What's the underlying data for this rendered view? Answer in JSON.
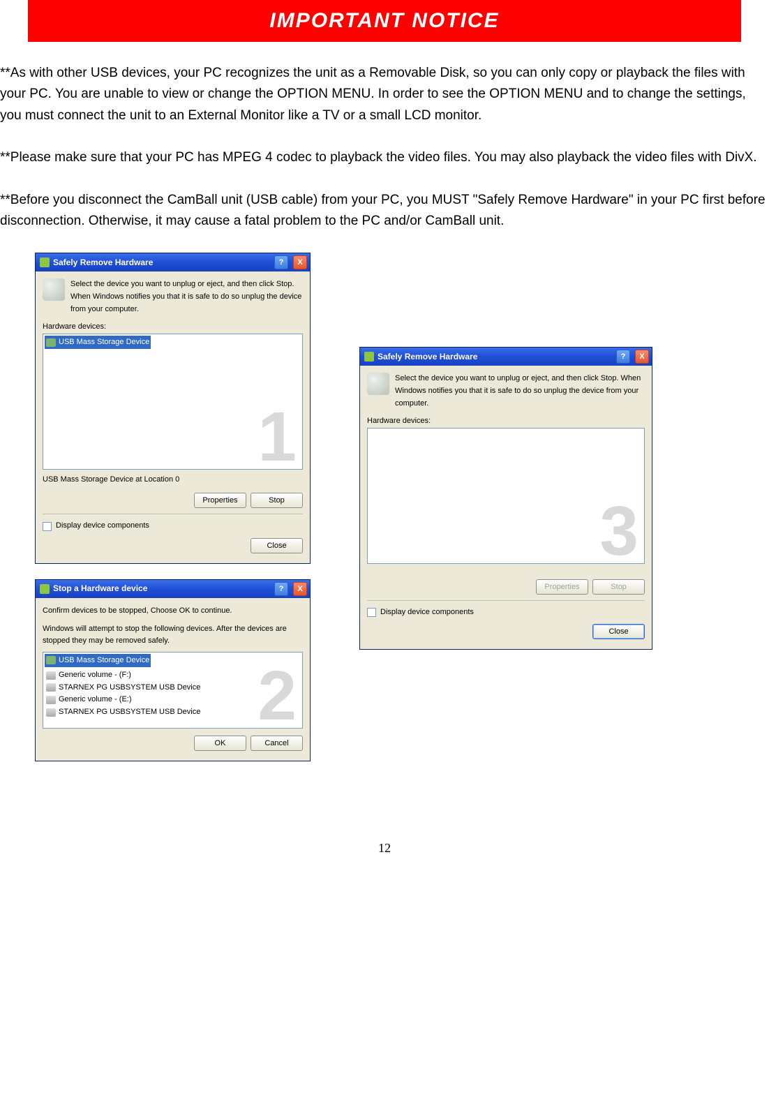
{
  "banner": {
    "text": "IMPORTANT  NOTICE"
  },
  "paragraphs": {
    "p1": "**As with other USB devices, your PC recognizes the unit as a Removable Disk, so you can only copy or playback the files with your PC. You are unable to view or change the OPTION MENU. In order to see the OPTION MENU and to change the settings, you must connect the unit to an External Monitor like a TV or a small LCD monitor.",
    "p2": "**Please make sure that your PC has MPEG 4 codec to playback the video files. You may also playback the video files with DivX.",
    "p3": "**Before you disconnect the CamBall unit (USB cable) from your PC, you MUST \"Safely Remove Hardware\" in your PC first before disconnection. Otherwise, it may cause a fatal problem to the PC and/or CamBall unit."
  },
  "dialog1": {
    "title": "Safely Remove Hardware",
    "help": "?",
    "close": "X",
    "instruction": "Select the device you want to unplug or eject, and then click Stop. When Windows notifies you that it is safe to do so unplug the device from your computer.",
    "hw_label": "Hardware devices:",
    "selected_item": "USB Mass Storage Device",
    "status": "USB Mass Storage Device at Location 0",
    "btn_properties": "Properties",
    "btn_stop": "Stop",
    "chk_label": "Display device components",
    "btn_close": "Close",
    "number": "1"
  },
  "dialog2": {
    "title": "Stop a Hardware device",
    "help": "?",
    "close": "X",
    "line1": "Confirm devices to be stopped, Choose OK to continue.",
    "line2": "Windows will attempt to stop the following devices. After the devices are stopped they may be removed safely.",
    "items": [
      "USB Mass Storage Device",
      "Generic volume - (F:)",
      "STARNEX PG USBSYSTEM USB Device",
      "Generic volume - (E:)",
      "STARNEX PG USBSYSTEM USB Device"
    ],
    "btn_ok": "OK",
    "btn_cancel": "Cancel",
    "number": "2"
  },
  "dialog3": {
    "title": "Safely Remove Hardware",
    "help": "?",
    "close": "X",
    "instruction": "Select the device you want to unplug or eject, and then click Stop. When Windows notifies you that it is safe to do so unplug the device from your computer.",
    "hw_label": "Hardware devices:",
    "btn_properties": "Properties",
    "btn_stop": "Stop",
    "chk_label": "Display device components",
    "btn_close": "Close",
    "number": "3"
  },
  "page_number": "12"
}
